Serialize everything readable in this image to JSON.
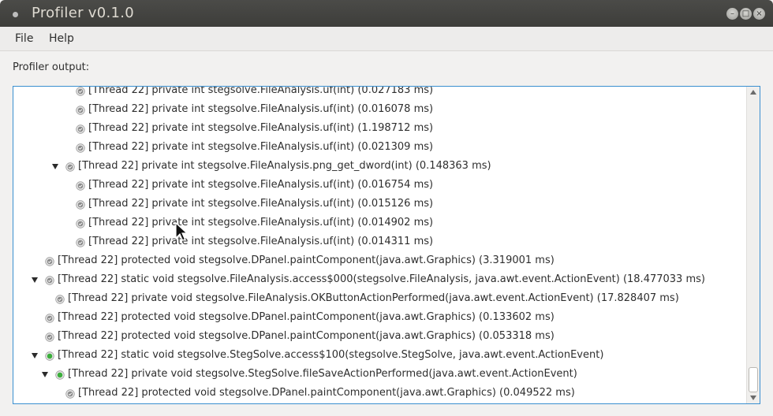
{
  "window": {
    "title": "Profiler v0.1.0"
  },
  "menu": {
    "file": "File",
    "help": "Help"
  },
  "panel": {
    "label": "Profiler output:"
  },
  "colors": {
    "accent": "#3a8fd0",
    "icon_gray": "#8a8a8a",
    "icon_green": "#3cae3c"
  },
  "tree": {
    "rows": [
      {
        "text": "[Thread 22] private int stegsolve.FileAnalysis.uf(int) (0.027183 ms)",
        "level": 3,
        "expanded": false,
        "icon": "gray"
      },
      {
        "text": "[Thread 22] private int stegsolve.FileAnalysis.uf(int) (0.016078 ms)",
        "level": 3,
        "expanded": false,
        "icon": "gray"
      },
      {
        "text": "[Thread 22] private int stegsolve.FileAnalysis.uf(int) (1.198712 ms)",
        "level": 3,
        "expanded": false,
        "icon": "gray"
      },
      {
        "text": "[Thread 22] private int stegsolve.FileAnalysis.uf(int) (0.021309 ms)",
        "level": 3,
        "expanded": false,
        "icon": "gray"
      },
      {
        "text": "[Thread 22] private int stegsolve.FileAnalysis.png_get_dword(int) (0.148363 ms)",
        "level": 2,
        "expanded": true,
        "icon": "gray"
      },
      {
        "text": "[Thread 22] private int stegsolve.FileAnalysis.uf(int) (0.016754 ms)",
        "level": 3,
        "expanded": false,
        "icon": "gray"
      },
      {
        "text": "[Thread 22] private int stegsolve.FileAnalysis.uf(int) (0.015126 ms)",
        "level": 3,
        "expanded": false,
        "icon": "gray"
      },
      {
        "text": "[Thread 22] private int stegsolve.FileAnalysis.uf(int) (0.014902 ms)",
        "level": 3,
        "expanded": false,
        "icon": "gray"
      },
      {
        "text": "[Thread 22] private int stegsolve.FileAnalysis.uf(int) (0.014311 ms)",
        "level": 3,
        "expanded": false,
        "icon": "gray"
      },
      {
        "text": "[Thread 22] protected void stegsolve.DPanel.paintComponent(java.awt.Graphics) (3.319001 ms)",
        "level": 0,
        "expanded": false,
        "icon": "gray"
      },
      {
        "text": "[Thread 22] static void stegsolve.FileAnalysis.access$000(stegsolve.FileAnalysis, java.awt.event.ActionEvent) (18.477033 ms)",
        "level": 0,
        "expanded": true,
        "icon": "gray"
      },
      {
        "text": "[Thread 22] private void stegsolve.FileAnalysis.OKButtonActionPerformed(java.awt.event.ActionEvent) (17.828407 ms)",
        "level": 1,
        "expanded": false,
        "icon": "gray"
      },
      {
        "text": "[Thread 22] protected void stegsolve.DPanel.paintComponent(java.awt.Graphics) (0.133602 ms)",
        "level": 0,
        "expanded": false,
        "icon": "gray"
      },
      {
        "text": "[Thread 22] protected void stegsolve.DPanel.paintComponent(java.awt.Graphics) (0.053318 ms)",
        "level": 0,
        "expanded": false,
        "icon": "gray"
      },
      {
        "text": "[Thread 22] static void stegsolve.StegSolve.access$100(stegsolve.StegSolve, java.awt.event.ActionEvent)",
        "level": 0,
        "expanded": true,
        "icon": "green"
      },
      {
        "text": "[Thread 22] private void stegsolve.StegSolve.fileSaveActionPerformed(java.awt.event.ActionEvent)",
        "level": 1,
        "expanded": true,
        "icon": "green"
      },
      {
        "text": "[Thread 22] protected void stegsolve.DPanel.paintComponent(java.awt.Graphics) (0.049522 ms)",
        "level": 2,
        "expanded": false,
        "icon": "gray"
      }
    ]
  }
}
